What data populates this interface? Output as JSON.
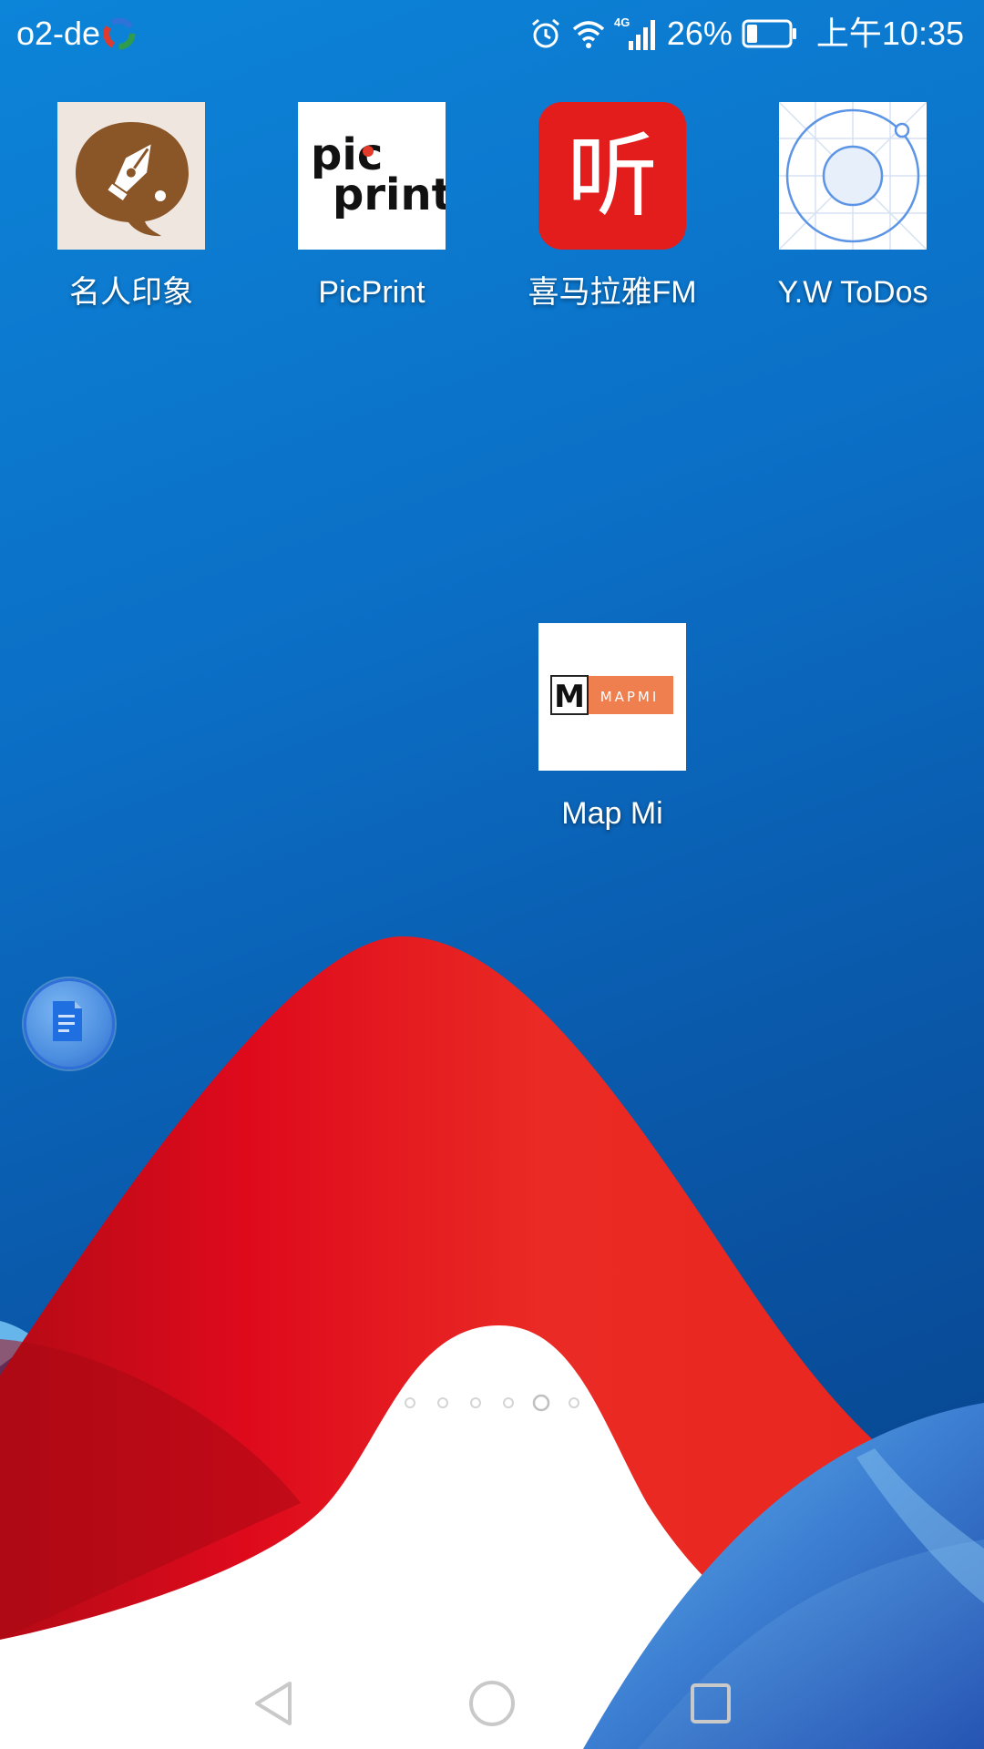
{
  "status_bar": {
    "carrier": "o2-de",
    "network_type": "4G",
    "battery_percent": "26%",
    "time": "上午10:35",
    "battery_level": 0.26,
    "icons": [
      "carrier-logo-icon",
      "alarm-icon",
      "wifi-icon",
      "signal-icon",
      "battery-icon"
    ]
  },
  "apps": [
    {
      "label": "名人印象",
      "icon": "fountain-pen-icon"
    },
    {
      "label": "PicPrint",
      "icon": "picprint-logo-icon",
      "logo_text": [
        "pic",
        "print"
      ]
    },
    {
      "label": "喜马拉雅FM",
      "icon": "ximalaya-logo-icon",
      "logo_text": "听"
    },
    {
      "label": "Y.W ToDos",
      "icon": "circle-grid-icon"
    },
    {
      "label": "Map Mi",
      "icon": "mapmi-logo-icon",
      "logo_text": "MAPMI",
      "logo_letter": "M"
    }
  ],
  "floating_bubble": {
    "icon": "document-icon"
  },
  "page_indicator": {
    "count": 6,
    "active_index": 4
  },
  "nav_bar": {
    "buttons": [
      "back-icon",
      "home-icon",
      "recents-icon"
    ]
  },
  "colors": {
    "background_top": "#0c84d8",
    "background_bottom": "#073f86",
    "wallpaper_red": "#e0121e",
    "ximalaya_red": "#e31d1c",
    "mapmi_orange": "#ef7f4f",
    "mingren_brown": "#8a5527"
  }
}
